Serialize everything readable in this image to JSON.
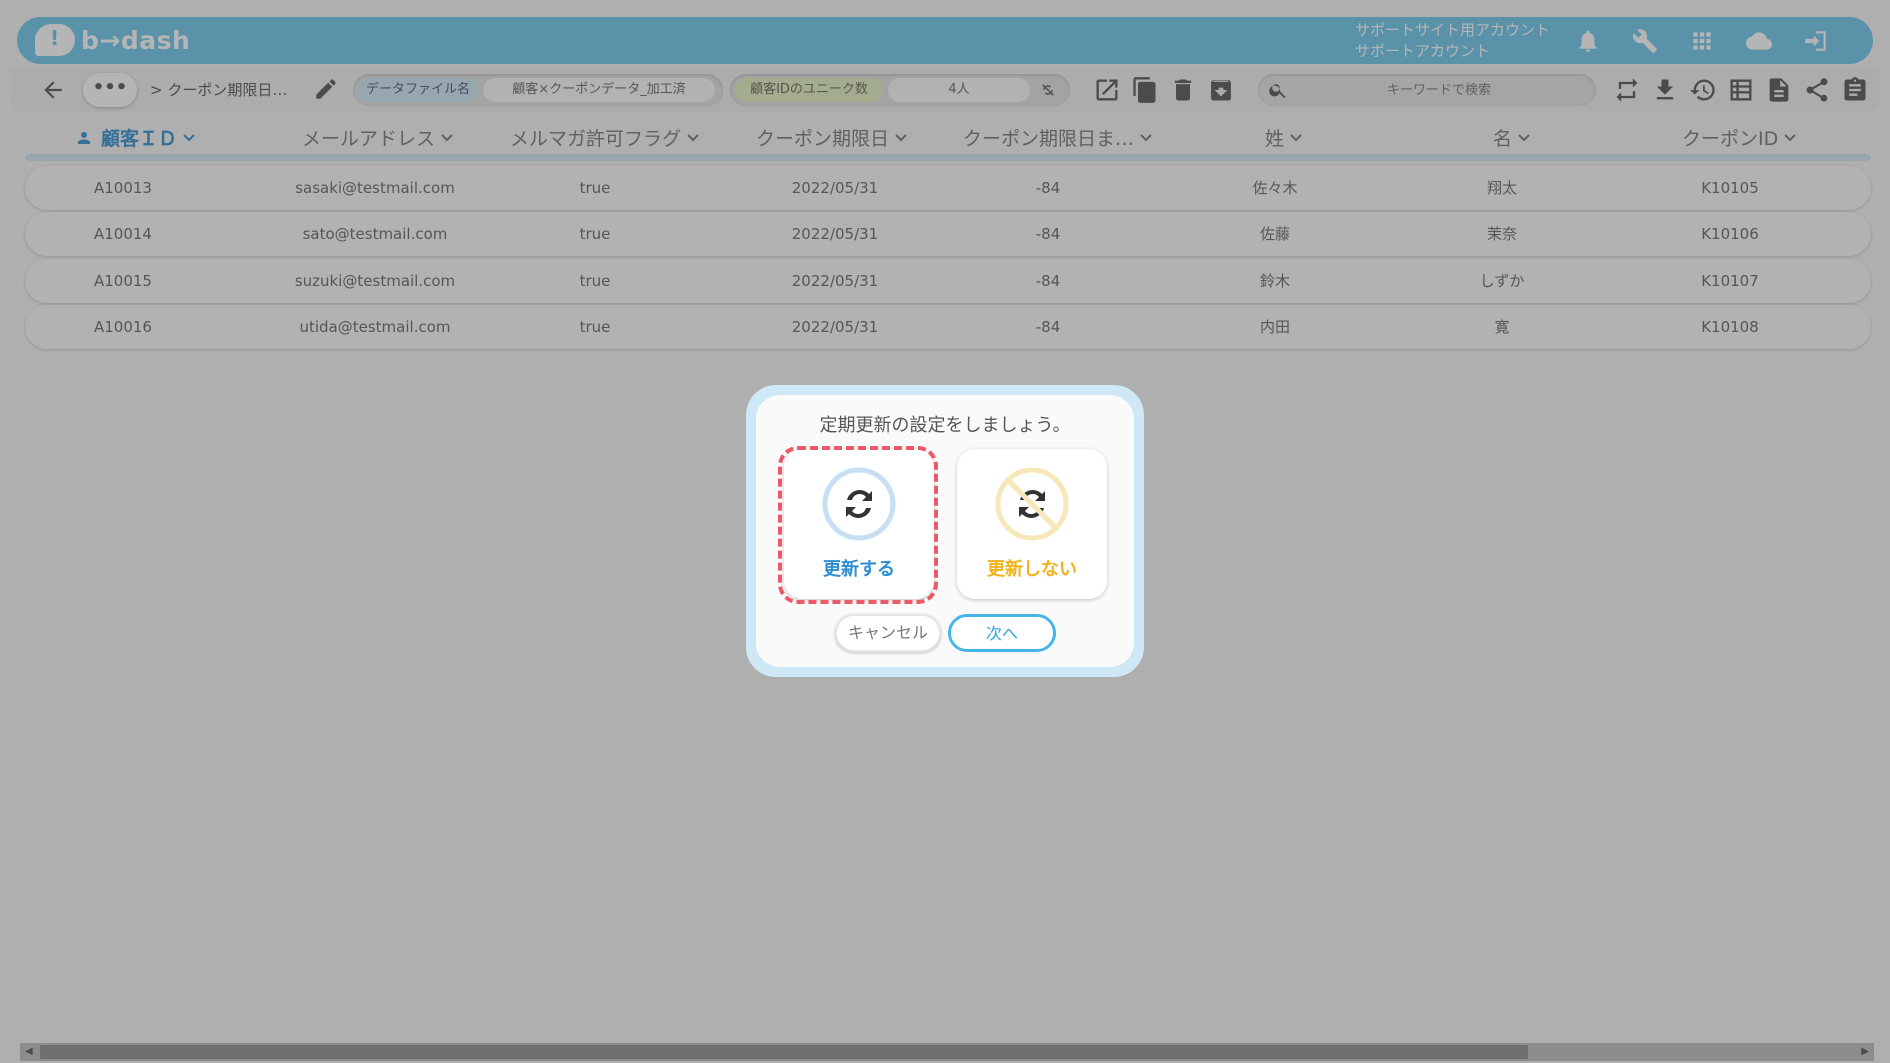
{
  "header": {
    "logo_text": "b→dash",
    "account_line1": "サポートサイト用アカウント",
    "account_line2": "サポートアカウント",
    "icons": [
      "bell-icon",
      "wrench-icon",
      "apps-grid-icon",
      "cloud-chat-icon",
      "logout-icon"
    ]
  },
  "toolbar": {
    "breadcrumb_more": "•••",
    "breadcrumb_text": "> クーポン期限日…",
    "datafile_label": "データファイル名",
    "datafile_value": "顧客×クーポンデータ_加工済",
    "unique_label": "顧客IDのユニーク数",
    "unique_value": "4人",
    "search_placeholder": "キーワードで検索"
  },
  "table": {
    "columns": [
      "顧客ＩＤ",
      "メールアドレス",
      "メルマガ許可フラグ",
      "クーポン期限日",
      "クーポン期限日ま…",
      "姓",
      "名",
      "クーポンID"
    ],
    "rows": [
      [
        "A10013",
        "sasaki@testmail.com",
        "true",
        "2022/05/31",
        "-84",
        "佐々木",
        "翔太",
        "K10105"
      ],
      [
        "A10014",
        "sato@testmail.com",
        "true",
        "2022/05/31",
        "-84",
        "佐藤",
        "茉奈",
        "K10106"
      ],
      [
        "A10015",
        "suzuki@testmail.com",
        "true",
        "2022/05/31",
        "-84",
        "鈴木",
        "しずか",
        "K10107"
      ],
      [
        "A10016",
        "utida@testmail.com",
        "true",
        "2022/05/31",
        "-84",
        "内田",
        "寛",
        "K10108"
      ]
    ]
  },
  "dialog": {
    "title": "定期更新の設定をしましょう。",
    "option_update": "更新する",
    "option_no_update": "更新しない",
    "cancel": "キャンセル",
    "next": "次へ"
  },
  "colors": {
    "header": "#6cc8ec",
    "accent_blue": "#2f8fd0",
    "accent_orange": "#f3b21b",
    "highlight_red": "#ec5866"
  }
}
